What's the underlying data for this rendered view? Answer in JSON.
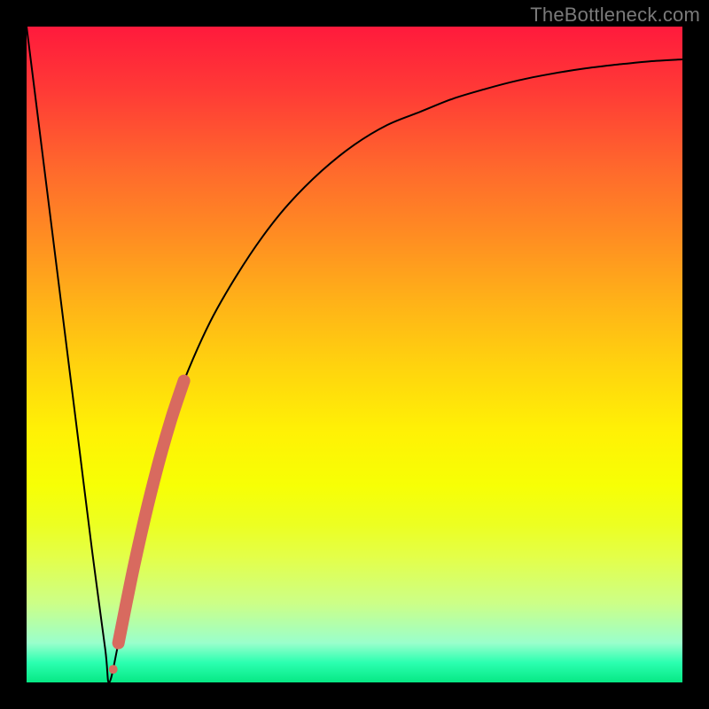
{
  "watermark": "TheBottleneck.com",
  "chart_data": {
    "type": "line",
    "title": "",
    "xlabel": "",
    "ylabel": "",
    "xlim": [
      0,
      100
    ],
    "ylim": [
      0,
      100
    ],
    "grid": false,
    "series": [
      {
        "name": "bottleneck-curve",
        "color": "#000000",
        "x": [
          0,
          2,
          4,
          6,
          8,
          10,
          12,
          12.6,
          14,
          16,
          18,
          20,
          22,
          24,
          28,
          32,
          36,
          40,
          45,
          50,
          55,
          60,
          65,
          70,
          75,
          80,
          85,
          90,
          95,
          100
        ],
        "values": [
          100,
          84,
          68,
          52,
          36,
          20,
          5,
          0,
          6,
          16,
          25,
          33,
          40,
          46,
          55,
          62,
          68,
          73,
          78,
          82,
          85,
          87,
          89,
          90.5,
          91.8,
          92.8,
          93.6,
          94.2,
          94.7,
          95
        ]
      },
      {
        "name": "highlight-segment",
        "color": "#d86a5f",
        "x": [
          14,
          16,
          18,
          20,
          22,
          24
        ],
        "values": [
          6,
          16,
          25,
          33,
          40,
          46
        ]
      }
    ]
  }
}
